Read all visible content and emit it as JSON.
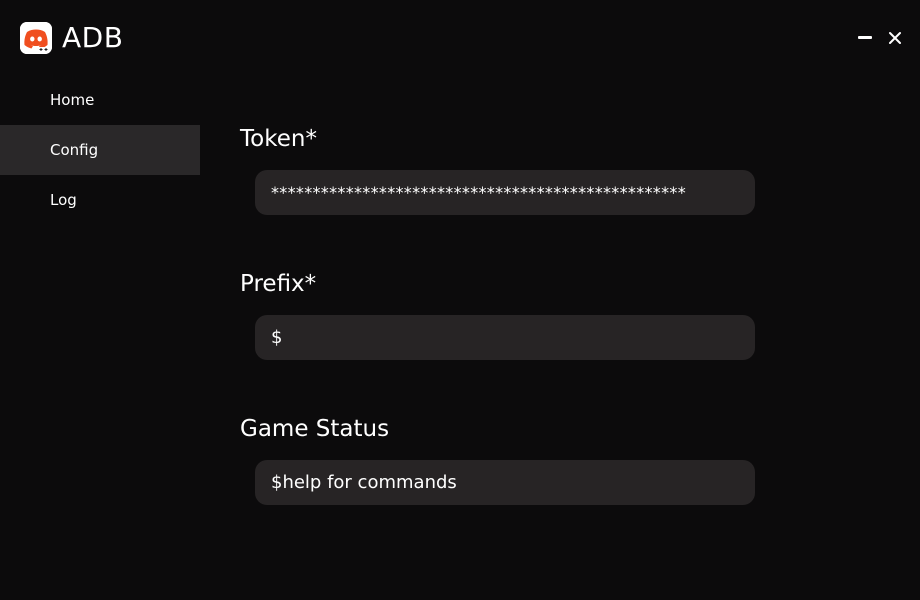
{
  "app": {
    "title": "ADB",
    "logo_icon": "discord-logo-icon",
    "accent_color": "#f04e1f"
  },
  "window_controls": {
    "minimize_icon": "minimize-icon",
    "close_icon": "close-icon"
  },
  "sidebar": {
    "items": [
      {
        "label": "Home",
        "active": false
      },
      {
        "label": "Config",
        "active": true
      },
      {
        "label": "Log",
        "active": false
      }
    ]
  },
  "config": {
    "token": {
      "label": "Token*",
      "value": "**************************************************"
    },
    "prefix": {
      "label": "Prefix*",
      "value": "$"
    },
    "game_status": {
      "label": "Game Status",
      "value": "$help for commands"
    }
  }
}
